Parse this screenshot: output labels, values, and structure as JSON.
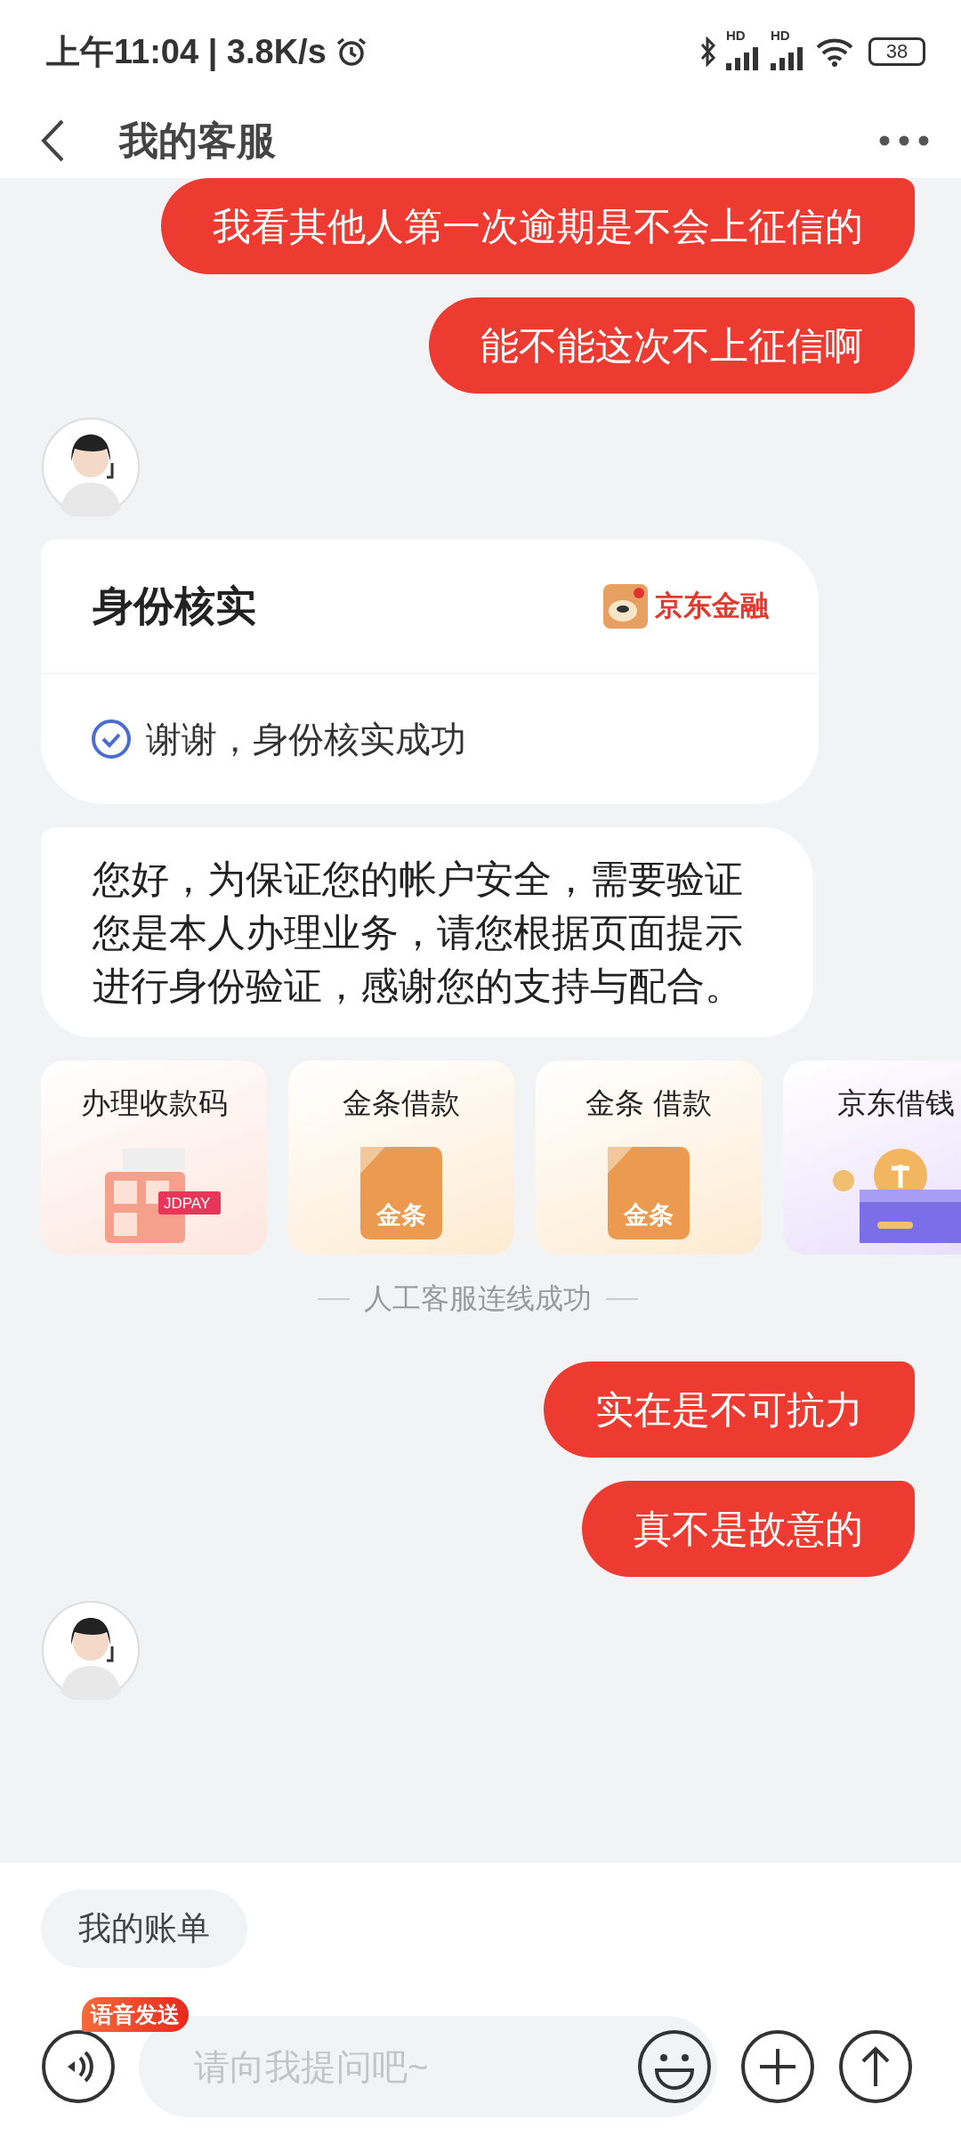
{
  "status_bar": {
    "time": "上午11:04 | 3.8K/s",
    "signals": [
      {
        "label": "HD"
      },
      {
        "label": "HD"
      }
    ],
    "battery": "38"
  },
  "header": {
    "title": "我的客服"
  },
  "messages": [
    {
      "kind": "outgoing",
      "text": "我看其他人第一次逾期是不会上征信的"
    },
    {
      "kind": "outgoing",
      "text": "能不能这次不上征信啊"
    },
    {
      "kind": "avatar"
    },
    {
      "kind": "verify_card",
      "title": "身份核实",
      "brand": "京东金融",
      "result": "谢谢，身份核实成功"
    },
    {
      "kind": "incoming",
      "text": "您好，为保证您的帐户安全，需要验证您是本人办理业务，请您根据页面提示进行身份验证，感谢您的支持与配合。"
    },
    {
      "kind": "quick_cards",
      "cards": [
        {
          "label": "办理收款码",
          "kind": "qr",
          "icon_text": "JDPAY"
        },
        {
          "label": "金条借款",
          "kind": "tile",
          "icon_text": "金条"
        },
        {
          "label": "金条 借款",
          "kind": "tile",
          "icon_text": "金条"
        },
        {
          "label": "京东借钱",
          "kind": "wallet"
        }
      ]
    },
    {
      "kind": "system",
      "text": "人工客服连线成功"
    },
    {
      "kind": "outgoing",
      "text": "实在是不可抗力"
    },
    {
      "kind": "outgoing",
      "text": "真不是故意的"
    },
    {
      "kind": "avatar"
    }
  ],
  "shortcuts": [
    "我的账单"
  ],
  "composer": {
    "voice_badge": "语音发送",
    "placeholder": "请向我提问吧~"
  }
}
